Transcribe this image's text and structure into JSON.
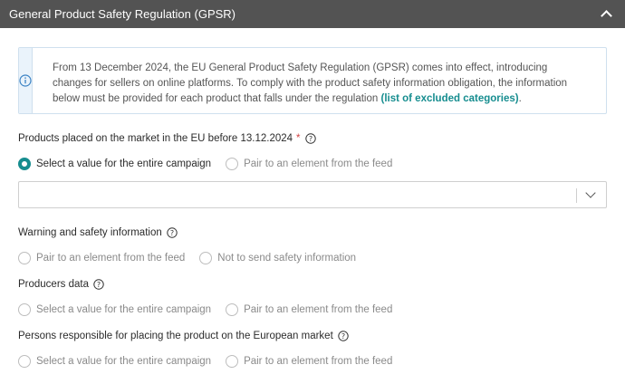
{
  "header": {
    "title": "General Product Safety Regulation (GPSR)",
    "collapse_icon": "chevron-up-icon"
  },
  "info": {
    "icon": "info-icon",
    "text_main": "From 13 December 2024, the EU General Product Safety Regulation (GPSR) comes into effect, introducing changes for sellers on online platforms. To comply with the product safety information obligation, the information below must be provided for each product that falls under the regulation ",
    "link_text": "(list of excluded categories)",
    "text_end": "."
  },
  "fields": {
    "products_placed": {
      "label": "Products placed on the market in the EU before 13.12.2024",
      "required_mark": "*",
      "options": [
        "Select a value for the entire campaign",
        "Pair to an element from the feed"
      ],
      "selected": "Select a value for the entire campaign",
      "select_value": ""
    },
    "warning_info": {
      "label": "Warning and safety information",
      "options": [
        "Pair to an element from the feed",
        "Not to send safety information"
      ]
    },
    "producers_data": {
      "label": "Producers data",
      "options": [
        "Select a value for the entire campaign",
        "Pair to an element from the feed"
      ]
    },
    "persons_responsible": {
      "label": "Persons responsible for placing the product on the European market",
      "options": [
        "Select a value for the entire campaign",
        "Pair to an element from the feed"
      ]
    }
  },
  "colors": {
    "header_bg": "#535353",
    "accent": "#168d8f",
    "info_bg": "#eaf3fb"
  }
}
